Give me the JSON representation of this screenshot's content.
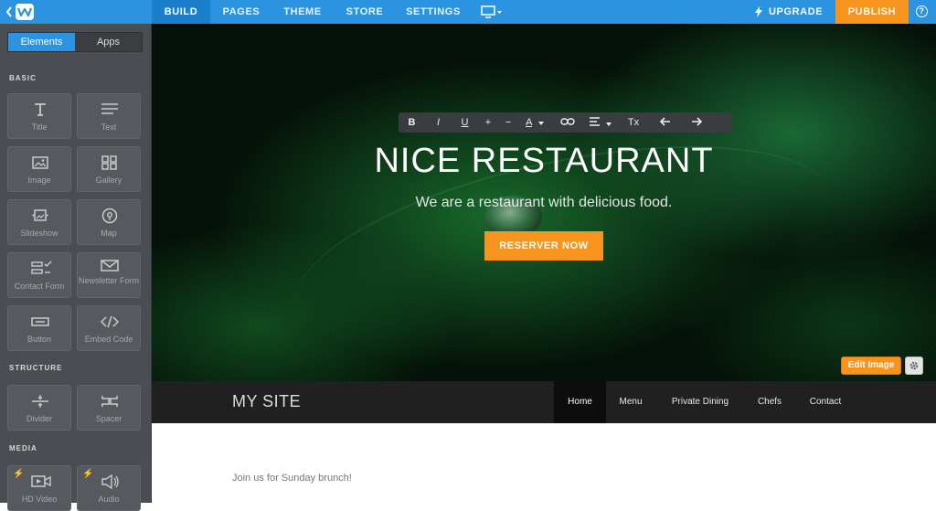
{
  "topbar": {
    "tabs": [
      "BUILD",
      "PAGES",
      "THEME",
      "STORE",
      "SETTINGS"
    ],
    "active_tab": "BUILD",
    "upgrade": "UPGRADE",
    "publish": "PUBLISH",
    "help": "?",
    "accent": "#2b93e0",
    "publish_color": "#f7941e"
  },
  "sidebar": {
    "seg": [
      "Elements",
      "Apps"
    ],
    "sections": [
      "BASIC",
      "STRUCTURE",
      "MEDIA"
    ],
    "basic": [
      "Title",
      "Text",
      "Image",
      "Gallery",
      "Slideshow",
      "Map",
      "Contact Form",
      "Newsletter Form",
      "Button",
      "Embed Code"
    ],
    "structure": [
      "Divider",
      "Spacer"
    ],
    "media": [
      "HD Video",
      "Audio"
    ]
  },
  "toolbar": {
    "items": [
      "B",
      "I",
      "U",
      "+",
      "−",
      "A",
      "link-icon",
      "align-icon",
      "Tx",
      "undo-icon",
      "redo-icon"
    ]
  },
  "hero": {
    "title": "NICE RESTAURANT",
    "subtitle": "We are a restaurant with delicious food.",
    "cta": "RESERVER NOW",
    "edit_image": "Edit Image"
  },
  "site": {
    "name": "MY SITE",
    "nav": [
      "Home",
      "Menu",
      "Private Dining",
      "Chefs",
      "Contact"
    ],
    "active_nav": "Home"
  },
  "content": {
    "text": "Join us for Sunday brunch!"
  }
}
